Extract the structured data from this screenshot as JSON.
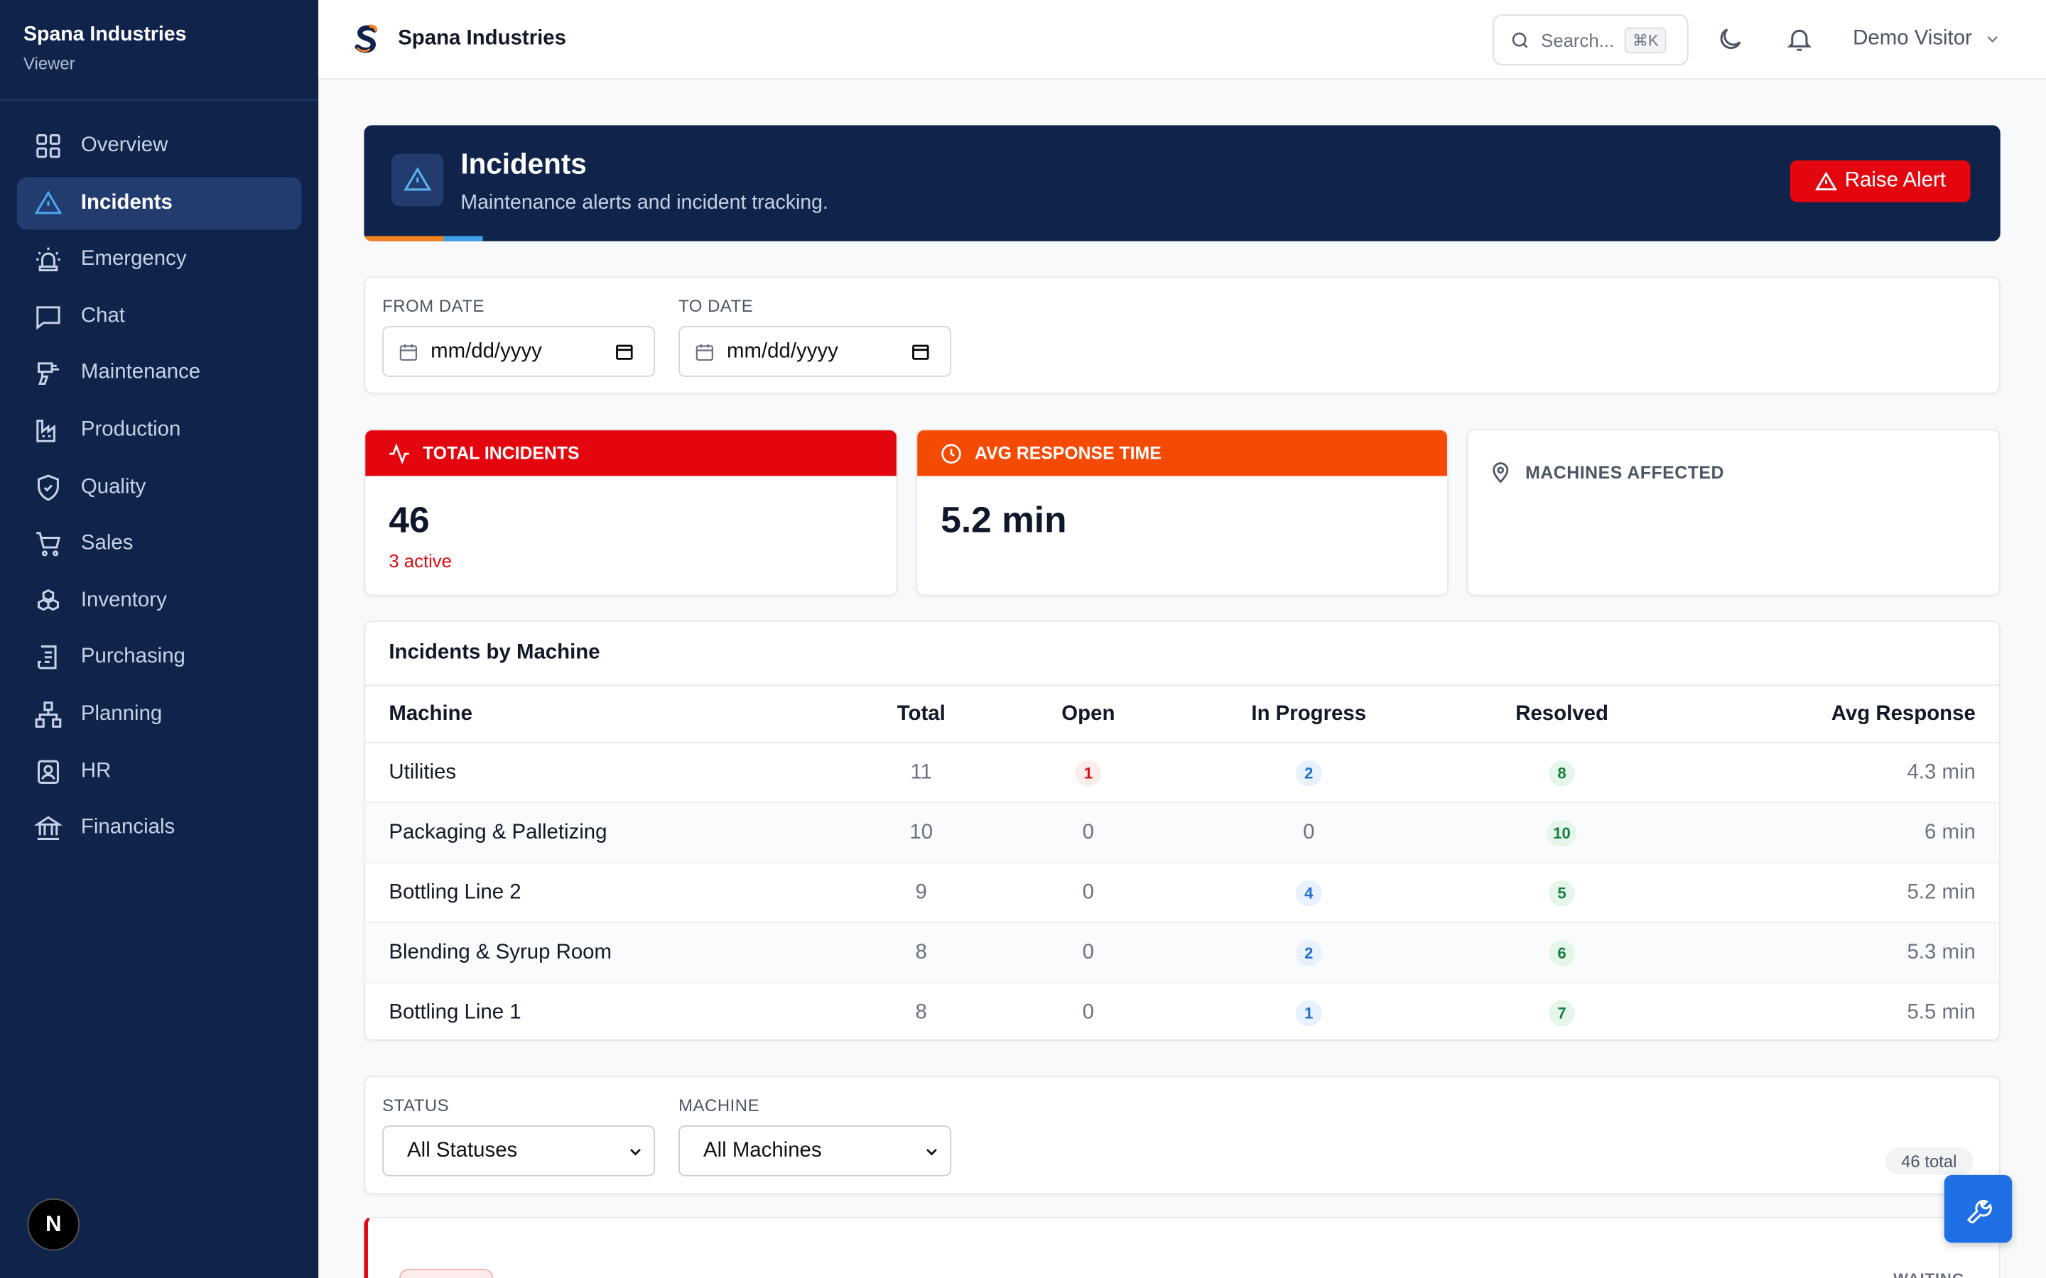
{
  "sidebar": {
    "company": "Spana Industries",
    "role": "Viewer",
    "items": [
      {
        "label": "Overview",
        "icon": "grid-icon"
      },
      {
        "label": "Incidents",
        "icon": "alert-triangle-icon",
        "active": true
      },
      {
        "label": "Emergency",
        "icon": "siren-icon"
      },
      {
        "label": "Chat",
        "icon": "chat-icon"
      },
      {
        "label": "Maintenance",
        "icon": "drill-icon"
      },
      {
        "label": "Production",
        "icon": "factory-icon"
      },
      {
        "label": "Quality",
        "icon": "shield-check-icon"
      },
      {
        "label": "Sales",
        "icon": "cart-icon"
      },
      {
        "label": "Inventory",
        "icon": "boxes-icon"
      },
      {
        "label": "Purchasing",
        "icon": "receipt-icon"
      },
      {
        "label": "Planning",
        "icon": "network-icon"
      },
      {
        "label": "HR",
        "icon": "id-badge-icon"
      },
      {
        "label": "Financials",
        "icon": "bank-icon"
      }
    ],
    "badge": "N"
  },
  "topbar": {
    "title": "Spana Industries",
    "search_placeholder": "Search...",
    "search_shortcut": "⌘K",
    "user": "Demo Visitor"
  },
  "hero": {
    "title": "Incidents",
    "subtitle": "Maintenance alerts and incident tracking.",
    "action": "Raise Alert"
  },
  "date_filter": {
    "from_label": "FROM DATE",
    "from_value": "mm/dd/yyyy",
    "to_label": "TO DATE",
    "to_value": "mm/dd/yyyy"
  },
  "stats": {
    "total": {
      "label": "TOTAL INCIDENTS",
      "value": "46",
      "sub": "3 active",
      "color": "#e4060e"
    },
    "response": {
      "label": "AVG RESPONSE TIME",
      "value": "5.2 min",
      "color": "#f54a03"
    },
    "machines": {
      "label": "MACHINES AFFECTED"
    }
  },
  "machine_table": {
    "title": "Incidents by Machine",
    "columns": [
      "Machine",
      "Total",
      "Open",
      "In Progress",
      "Resolved",
      "Avg Response"
    ],
    "rows": [
      {
        "machine": "Utilities",
        "total": "11",
        "open": "1",
        "in_progress": "2",
        "resolved": "8",
        "avg": "4.3 min"
      },
      {
        "machine": "Packaging & Palletizing",
        "total": "10",
        "open": "0",
        "in_progress": "0",
        "resolved": "10",
        "avg": "6 min"
      },
      {
        "machine": "Bottling Line 2",
        "total": "9",
        "open": "0",
        "in_progress": "4",
        "resolved": "5",
        "avg": "5.2 min"
      },
      {
        "machine": "Blending & Syrup Room",
        "total": "8",
        "open": "0",
        "in_progress": "2",
        "resolved": "6",
        "avg": "5.3 min"
      },
      {
        "machine": "Bottling Line 1",
        "total": "8",
        "open": "0",
        "in_progress": "1",
        "resolved": "7",
        "avg": "5.5 min"
      }
    ]
  },
  "list_filter": {
    "status_label": "STATUS",
    "status_value": "All Statuses",
    "machine_label": "MACHINE",
    "machine_value": "All Machines",
    "total_badge": "46 total"
  },
  "incident_card": {
    "status": "WAITING"
  }
}
